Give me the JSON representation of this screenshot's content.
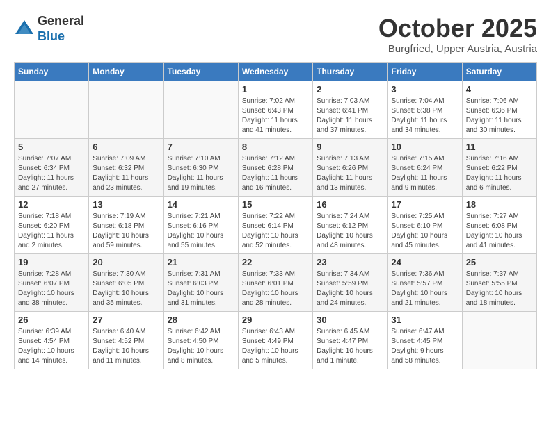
{
  "header": {
    "logo_general": "General",
    "logo_blue": "Blue",
    "month": "October 2025",
    "location": "Burgfried, Upper Austria, Austria"
  },
  "weekdays": [
    "Sunday",
    "Monday",
    "Tuesday",
    "Wednesday",
    "Thursday",
    "Friday",
    "Saturday"
  ],
  "weeks": [
    [
      {
        "day": "",
        "info": ""
      },
      {
        "day": "",
        "info": ""
      },
      {
        "day": "",
        "info": ""
      },
      {
        "day": "1",
        "info": "Sunrise: 7:02 AM\nSunset: 6:43 PM\nDaylight: 11 hours\nand 41 minutes."
      },
      {
        "day": "2",
        "info": "Sunrise: 7:03 AM\nSunset: 6:41 PM\nDaylight: 11 hours\nand 37 minutes."
      },
      {
        "day": "3",
        "info": "Sunrise: 7:04 AM\nSunset: 6:38 PM\nDaylight: 11 hours\nand 34 minutes."
      },
      {
        "day": "4",
        "info": "Sunrise: 7:06 AM\nSunset: 6:36 PM\nDaylight: 11 hours\nand 30 minutes."
      }
    ],
    [
      {
        "day": "5",
        "info": "Sunrise: 7:07 AM\nSunset: 6:34 PM\nDaylight: 11 hours\nand 27 minutes."
      },
      {
        "day": "6",
        "info": "Sunrise: 7:09 AM\nSunset: 6:32 PM\nDaylight: 11 hours\nand 23 minutes."
      },
      {
        "day": "7",
        "info": "Sunrise: 7:10 AM\nSunset: 6:30 PM\nDaylight: 11 hours\nand 19 minutes."
      },
      {
        "day": "8",
        "info": "Sunrise: 7:12 AM\nSunset: 6:28 PM\nDaylight: 11 hours\nand 16 minutes."
      },
      {
        "day": "9",
        "info": "Sunrise: 7:13 AM\nSunset: 6:26 PM\nDaylight: 11 hours\nand 13 minutes."
      },
      {
        "day": "10",
        "info": "Sunrise: 7:15 AM\nSunset: 6:24 PM\nDaylight: 11 hours\nand 9 minutes."
      },
      {
        "day": "11",
        "info": "Sunrise: 7:16 AM\nSunset: 6:22 PM\nDaylight: 11 hours\nand 6 minutes."
      }
    ],
    [
      {
        "day": "12",
        "info": "Sunrise: 7:18 AM\nSunset: 6:20 PM\nDaylight: 11 hours\nand 2 minutes."
      },
      {
        "day": "13",
        "info": "Sunrise: 7:19 AM\nSunset: 6:18 PM\nDaylight: 10 hours\nand 59 minutes."
      },
      {
        "day": "14",
        "info": "Sunrise: 7:21 AM\nSunset: 6:16 PM\nDaylight: 10 hours\nand 55 minutes."
      },
      {
        "day": "15",
        "info": "Sunrise: 7:22 AM\nSunset: 6:14 PM\nDaylight: 10 hours\nand 52 minutes."
      },
      {
        "day": "16",
        "info": "Sunrise: 7:24 AM\nSunset: 6:12 PM\nDaylight: 10 hours\nand 48 minutes."
      },
      {
        "day": "17",
        "info": "Sunrise: 7:25 AM\nSunset: 6:10 PM\nDaylight: 10 hours\nand 45 minutes."
      },
      {
        "day": "18",
        "info": "Sunrise: 7:27 AM\nSunset: 6:08 PM\nDaylight: 10 hours\nand 41 minutes."
      }
    ],
    [
      {
        "day": "19",
        "info": "Sunrise: 7:28 AM\nSunset: 6:07 PM\nDaylight: 10 hours\nand 38 minutes."
      },
      {
        "day": "20",
        "info": "Sunrise: 7:30 AM\nSunset: 6:05 PM\nDaylight: 10 hours\nand 35 minutes."
      },
      {
        "day": "21",
        "info": "Sunrise: 7:31 AM\nSunset: 6:03 PM\nDaylight: 10 hours\nand 31 minutes."
      },
      {
        "day": "22",
        "info": "Sunrise: 7:33 AM\nSunset: 6:01 PM\nDaylight: 10 hours\nand 28 minutes."
      },
      {
        "day": "23",
        "info": "Sunrise: 7:34 AM\nSunset: 5:59 PM\nDaylight: 10 hours\nand 24 minutes."
      },
      {
        "day": "24",
        "info": "Sunrise: 7:36 AM\nSunset: 5:57 PM\nDaylight: 10 hours\nand 21 minutes."
      },
      {
        "day": "25",
        "info": "Sunrise: 7:37 AM\nSunset: 5:55 PM\nDaylight: 10 hours\nand 18 minutes."
      }
    ],
    [
      {
        "day": "26",
        "info": "Sunrise: 6:39 AM\nSunset: 4:54 PM\nDaylight: 10 hours\nand 14 minutes."
      },
      {
        "day": "27",
        "info": "Sunrise: 6:40 AM\nSunset: 4:52 PM\nDaylight: 10 hours\nand 11 minutes."
      },
      {
        "day": "28",
        "info": "Sunrise: 6:42 AM\nSunset: 4:50 PM\nDaylight: 10 hours\nand 8 minutes."
      },
      {
        "day": "29",
        "info": "Sunrise: 6:43 AM\nSunset: 4:49 PM\nDaylight: 10 hours\nand 5 minutes."
      },
      {
        "day": "30",
        "info": "Sunrise: 6:45 AM\nSunset: 4:47 PM\nDaylight: 10 hours\nand 1 minute."
      },
      {
        "day": "31",
        "info": "Sunrise: 6:47 AM\nSunset: 4:45 PM\nDaylight: 9 hours\nand 58 minutes."
      },
      {
        "day": "",
        "info": ""
      }
    ]
  ]
}
